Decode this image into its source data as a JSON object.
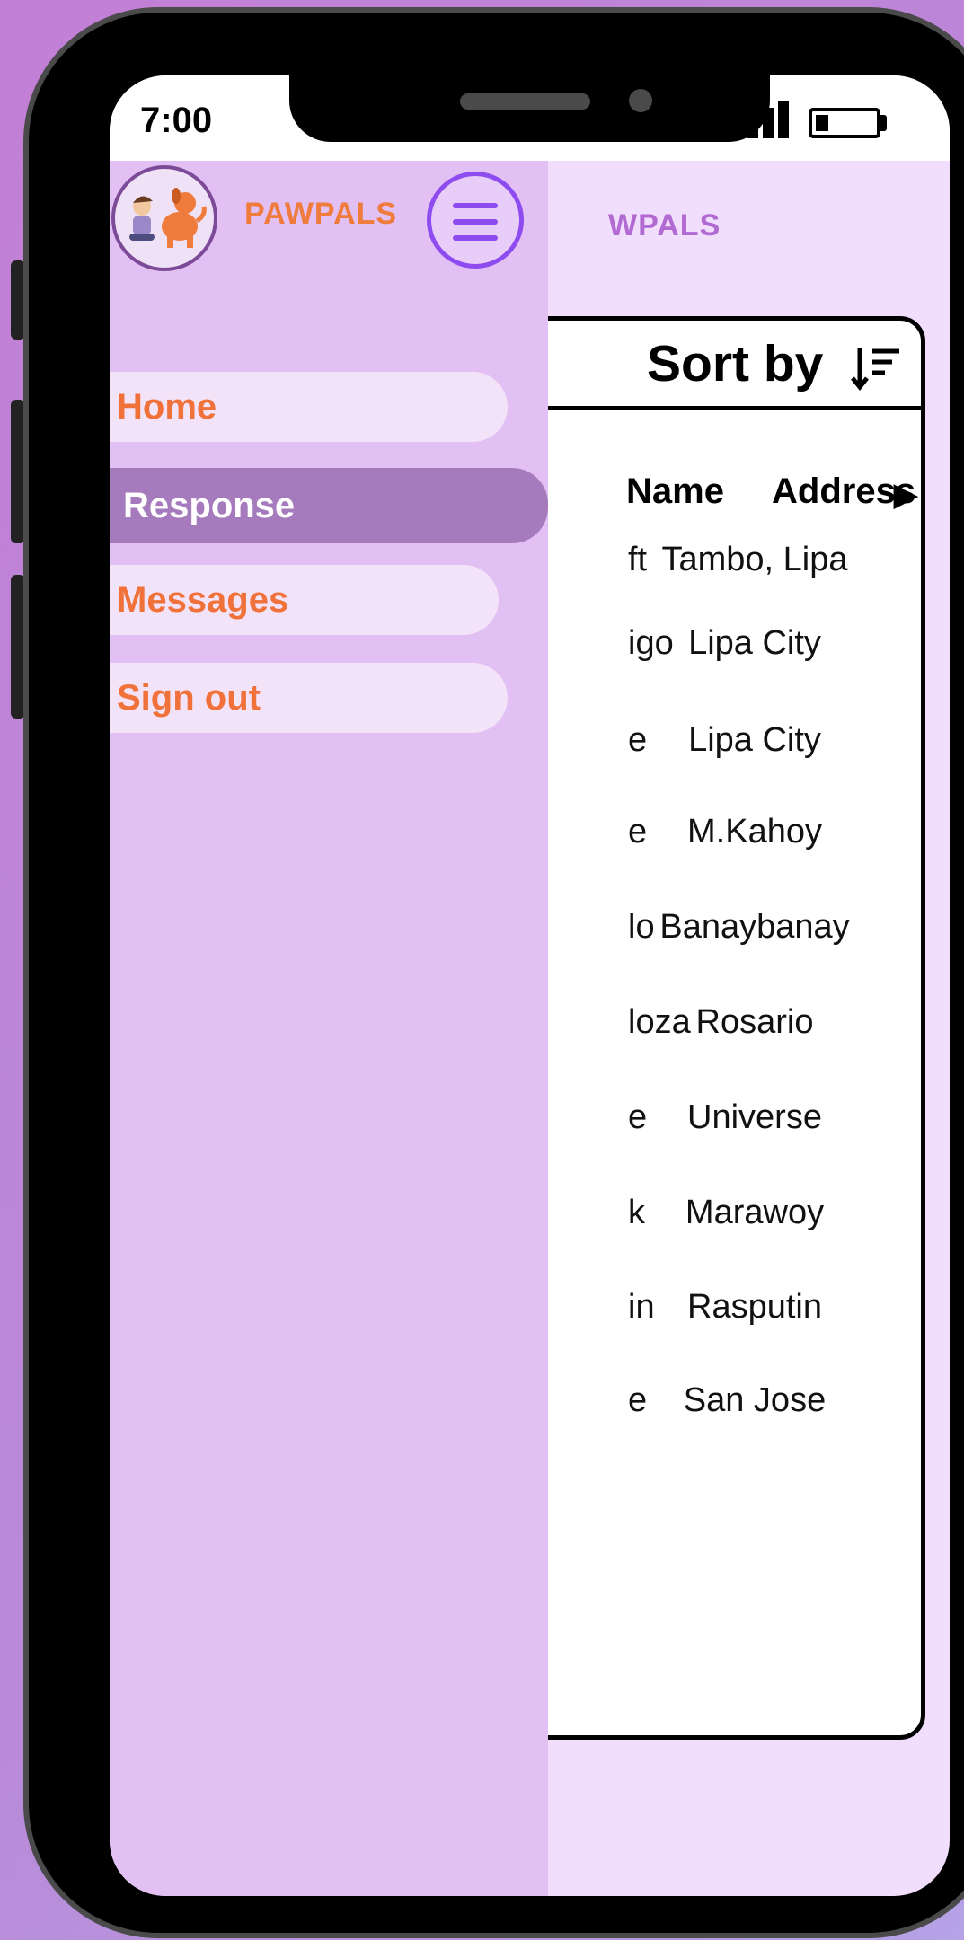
{
  "status_bar": {
    "time": "7:00"
  },
  "app": {
    "brand": "PAWPALS",
    "background_brand": "WPALS"
  },
  "drawer": {
    "items": [
      {
        "label": "Home",
        "active": false
      },
      {
        "label": "Response",
        "active": true
      },
      {
        "label": "Messages",
        "active": false
      },
      {
        "label": "Sign out",
        "active": false
      }
    ]
  },
  "table": {
    "sort_label": "Sort by",
    "columns": {
      "name": "Name",
      "address": "Address"
    },
    "sort_arrow": "▶",
    "rows": [
      {
        "name": "ft",
        "address": "Tambo, Lipa"
      },
      {
        "name": "igo",
        "address": "Lipa City"
      },
      {
        "name": "e",
        "address": "Lipa City"
      },
      {
        "name": "e",
        "address": "M.Kahoy"
      },
      {
        "name": "lo",
        "address": "Banaybanay"
      },
      {
        "name": "loza",
        "address": "Rosario"
      },
      {
        "name": "e",
        "address": "Universe"
      },
      {
        "name": "k",
        "address": "Marawoy"
      },
      {
        "name": "in",
        "address": "Rasputin"
      },
      {
        "name": "e",
        "address": "San Jose"
      }
    ]
  },
  "colors": {
    "drawer_bg": "#e2c0f4",
    "active_item": "#a67bbd",
    "accent_orange": "#f0723a",
    "menu_purple": "#8e4cf0"
  },
  "icons": {
    "menu": "hamburger-icon",
    "sort": "sort-descending-icon",
    "logo": "child-and-dog-logo"
  }
}
